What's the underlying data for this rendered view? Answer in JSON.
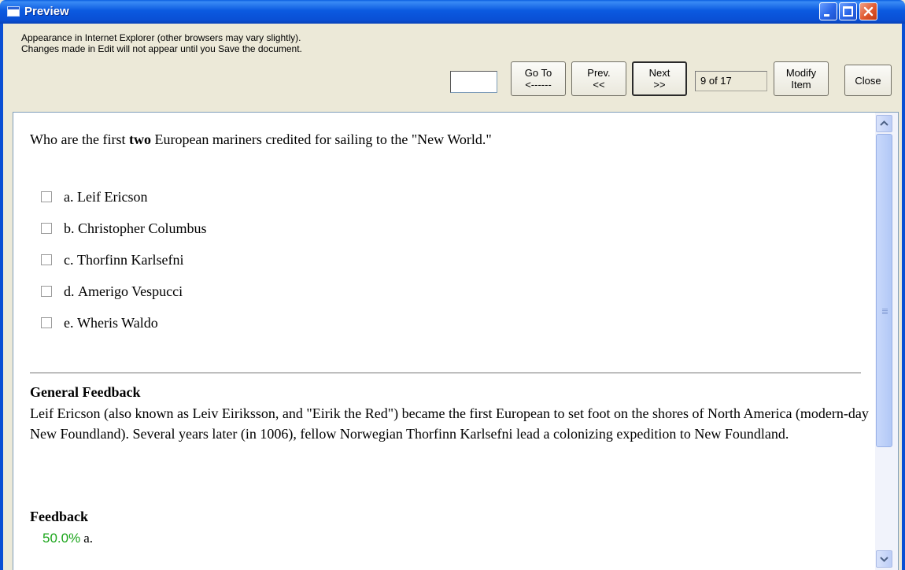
{
  "window": {
    "title": "Preview"
  },
  "toolbar": {
    "info_line1": "Appearance in Internet Explorer (other browsers may vary slightly).",
    "info_line2": "Changes made in Edit will not appear until you Save the document.",
    "goto_value": "",
    "goto_line1": "Go To",
    "goto_line2": "<------",
    "prev_line1": "Prev.",
    "prev_line2": "<<",
    "next_line1": "Next",
    "next_line2": ">>",
    "counter": "9 of 17",
    "modify_line1": "Modify",
    "modify_line2": "Item",
    "close_label": "Close"
  },
  "question": {
    "before": "Who are the first ",
    "emphasis": "two",
    "after": " European mariners credited for sailing to the \"New World.\"",
    "choices": [
      {
        "letter": "a.",
        "text": "Leif Ericson",
        "checked": false
      },
      {
        "letter": "b.",
        "text": "Christopher Columbus",
        "checked": false
      },
      {
        "letter": "c.",
        "text": "Thorfinn Karlsefni",
        "checked": false
      },
      {
        "letter": "d.",
        "text": "Amerigo Vespucci",
        "checked": false
      },
      {
        "letter": "e.",
        "text": "Wheris Waldo",
        "checked": false
      }
    ]
  },
  "general_feedback": {
    "title": "General Feedback",
    "text": "Leif Ericson (also known as Leiv Eiriksson, and \"Eirik the Red\") became the first European to set foot on the shores of North America (modern-day New Foundland). Several years later (in 1006), fellow Norwegian Thorfinn Karlsefni lead a colonizing expedition to New Foundland."
  },
  "feedback": {
    "title": "Feedback",
    "rows": [
      {
        "percent": "50.0%",
        "letter": "a."
      }
    ]
  },
  "colors": {
    "title_bar": "#0a4fd4",
    "feedback_percent": "#1aa51a",
    "window_face": "#ece9d8"
  },
  "icons": {
    "app": "window-icon",
    "minimize": "minimize-icon",
    "maximize": "maximize-icon",
    "close": "close-icon"
  }
}
